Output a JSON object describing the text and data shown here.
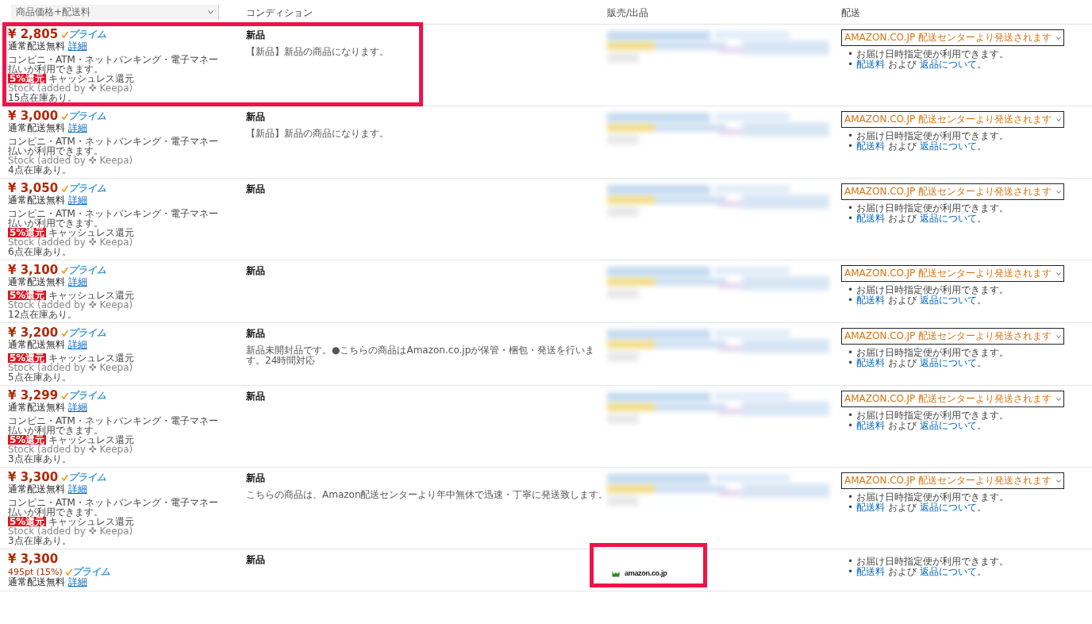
{
  "columns": {
    "price": "商品価格+配送料",
    "condition": "コンディション",
    "seller": "販売/出品",
    "delivery": "配送"
  },
  "rows": [
    {
      "price": "¥ 2,805",
      "prime": "プライム",
      "shipping": "通常配送無料",
      "detail_link": "詳細",
      "payment": "コンビニ・ATM・ネットバンキング・電子マネー払いが利用できます。",
      "cashback": {
        "badge": "5%還元",
        "label": "キャッシュレス還元"
      },
      "stock_source": "Stock (added by ✜ Keepa)",
      "stock": "15点在庫あり。",
      "condition": "新品",
      "description": "【新品】新品の商品になります。",
      "delivery": {
        "select": "AMAZON.CO.JP 配送センターより発送されます",
        "bullet": "•",
        "note": "お届け日時指定便が利用できます。",
        "link1": "配送料",
        "middle": "および",
        "link2": "返品について",
        "end": "。"
      },
      "highlighted": true
    },
    {
      "price": "¥ 3,000",
      "prime": "プライム",
      "shipping": "通常配送無料",
      "detail_link": "詳細",
      "payment": "コンビニ・ATM・ネットバンキング・電子マネー払いが利用できます。",
      "stock_source": "Stock (added by ✜ Keepa)",
      "stock": "4点在庫あり。",
      "condition": "新品",
      "description": "【新品】新品の商品になります。",
      "delivery": {
        "select": "AMAZON.CO.JP 配送センターより発送されます",
        "bullet": "•",
        "note": "お届け日時指定便が利用できます。",
        "link1": "配送料",
        "middle": "および",
        "link2": "返品について",
        "end": "。"
      }
    },
    {
      "price": "¥ 3,050",
      "prime": "プライム",
      "shipping": "通常配送無料",
      "detail_link": "詳細",
      "payment": "コンビニ・ATM・ネットバンキング・電子マネー払いが利用できます。",
      "cashback": {
        "badge": "5%還元",
        "label": "キャッシュレス還元"
      },
      "stock_source": "Stock (added by ✜ Keepa)",
      "stock": "6点在庫あり。",
      "condition": "新品",
      "delivery": {
        "select": "AMAZON.CO.JP 配送センターより発送されます",
        "bullet": "•",
        "note": "お届け日時指定便が利用できます。",
        "link1": "配送料",
        "middle": "および",
        "link2": "返品について",
        "end": "。"
      }
    },
    {
      "price": "¥ 3,100",
      "prime": "プライム",
      "shipping": "通常配送無料",
      "detail_link": "詳細",
      "cashback": {
        "badge": "5%還元",
        "label": "キャッシュレス還元"
      },
      "stock_source": "Stock (added by ✜ Keepa)",
      "stock": "12点在庫あり。",
      "condition": "新品",
      "delivery": {
        "select": "AMAZON.CO.JP 配送センターより発送されます",
        "bullet": "•",
        "note": "お届け日時指定便が利用できます。",
        "link1": "配送料",
        "middle": "および",
        "link2": "返品について",
        "end": "。"
      }
    },
    {
      "price": "¥ 3,200",
      "prime": "プライム",
      "shipping": "通常配送無料",
      "detail_link": "詳細",
      "cashback": {
        "badge": "5%還元",
        "label": "キャッシュレス還元"
      },
      "stock_source": "Stock (added by ✜ Keepa)",
      "stock": "5点在庫あり。",
      "condition": "新品",
      "description": "新品未開封品です。●こちらの商品はAmazon.co.jpが保管・梱包・発送を行います。24時間対応",
      "delivery": {
        "select": "AMAZON.CO.JP 配送センターより発送されます",
        "bullet": "•",
        "note": "お届け日時指定便が利用できます。",
        "link1": "配送料",
        "middle": "および",
        "link2": "返品について",
        "end": "。"
      }
    },
    {
      "price": "¥ 3,299",
      "prime": "プライム",
      "shipping": "通常配送無料",
      "detail_link": "詳細",
      "payment": "コンビニ・ATM・ネットバンキング・電子マネー払いが利用できます。",
      "cashback": {
        "badge": "5%還元",
        "label": "キャッシュレス還元"
      },
      "stock_source": "Stock (added by ✜ Keepa)",
      "stock": "3点在庫あり。",
      "condition": "新品",
      "delivery": {
        "select": "AMAZON.CO.JP 配送センターより発送されます",
        "bullet": "•",
        "note": "お届け日時指定便が利用できます。",
        "link1": "配送料",
        "middle": "および",
        "link2": "返品について",
        "end": "。"
      }
    },
    {
      "price": "¥ 3,300",
      "prime": "プライム",
      "shipping": "通常配送無料",
      "detail_link": "詳細",
      "payment": "コンビニ・ATM・ネットバンキング・電子マネー払いが利用できます。",
      "cashback": {
        "badge": "5%還元",
        "label": "キャッシュレス還元"
      },
      "stock_source": "Stock (added by ✜ Keepa)",
      "stock": "3点在庫あり。",
      "condition": "新品",
      "description": "こちらの商品は、Amazon配送センターより年中無休で迅速・丁寧に発送致します。",
      "delivery": {
        "select": "AMAZON.CO.JP 配送センターより発送されます",
        "bullet": "•",
        "note": "お届け日時指定便が利用できます。",
        "link1": "配送料",
        "middle": "および",
        "link2": "返品について",
        "end": "。"
      }
    },
    {
      "price": "¥ 3,300",
      "points": "495pt (15%)",
      "prime": "プライム",
      "shipping": "通常配送無料",
      "detail_link": "詳細",
      "condition": "新品",
      "seller": {
        "kind": "logo",
        "logo_text": "amazon.co.jp",
        "highlighted": true
      },
      "delivery": {
        "bullet": "•",
        "note": "お届け日時指定便が利用できます。",
        "link1": "配送料",
        "middle": "および",
        "link2": "返品について",
        "end": "。"
      }
    }
  ]
}
